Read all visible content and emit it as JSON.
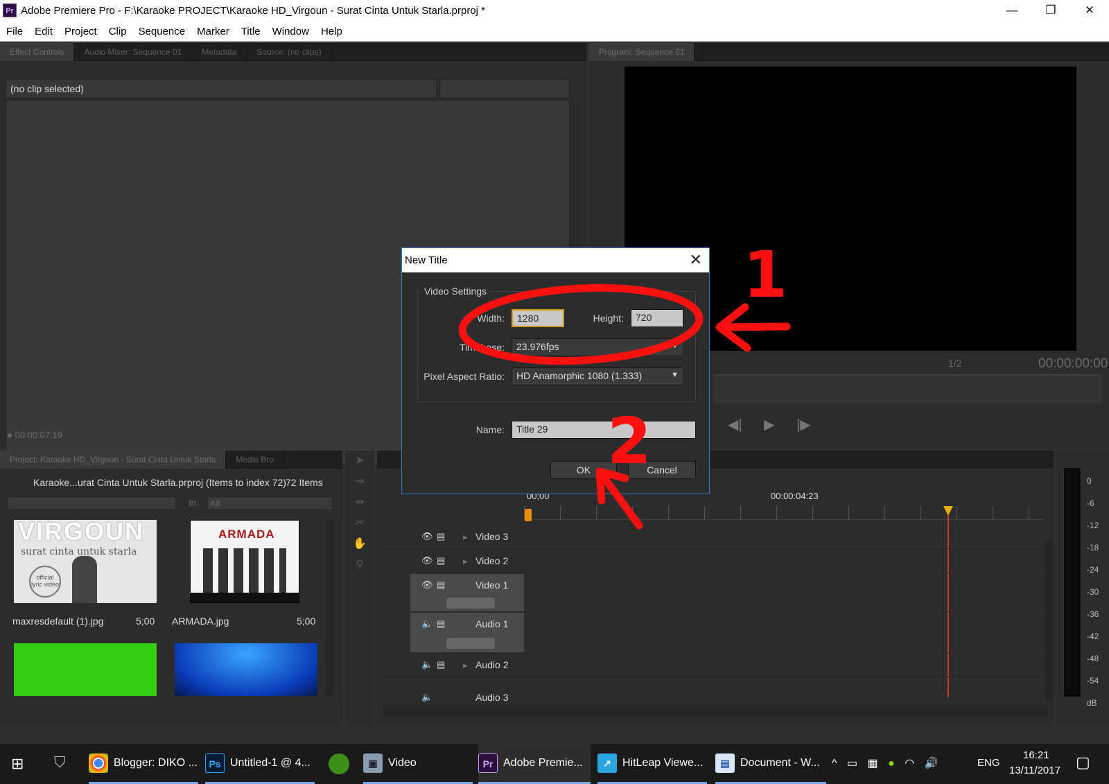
{
  "window": {
    "app_icon": "Pr",
    "title": "Adobe Premiere Pro - F:\\Karaoke PROJECT\\Karaoke HD_Virgoun - Surat Cinta Untuk Starla.prproj *",
    "min_icon": "—",
    "restore_icon": "❐",
    "close_icon": "✕"
  },
  "menu": [
    "File",
    "Edit",
    "Project",
    "Clip",
    "Sequence",
    "Marker",
    "Title",
    "Window",
    "Help"
  ],
  "source_panel": {
    "tabs": [
      "Effect Controls",
      "Audio Mixer: Sequence 01",
      "Metadata",
      "Source: (no clips)"
    ],
    "no_clip": "(no clip selected)",
    "timecode": "00:00:07:19"
  },
  "program_panel": {
    "tab": "Program: Sequence 01",
    "timecode": "00:00:00:00",
    "zoom": "1/2"
  },
  "project_panel": {
    "tabs": [
      "Project: Karaoke HD_Virgoun - Surat Cinta Untuk Starla",
      "Media Bro"
    ],
    "file_label": "Karaoke...urat Cinta Untuk Starla.prproj (Items to index 72)",
    "item_count": "72 Items",
    "in_label": "In:",
    "in_value": "All",
    "items": [
      {
        "name": "maxresdefault (1).jpg",
        "duration": "5;00"
      },
      {
        "name": "ARMADA.jpg",
        "duration": "5;00"
      }
    ],
    "thumb1_text": [
      "VIRGOUN",
      "surat cinta untuk starla",
      "official lyric video"
    ],
    "thumb2_text": "ARMADA"
  },
  "timeline": {
    "timecodes": [
      "00;00",
      "00:00:04:23"
    ],
    "tracks": [
      "Video 3",
      "Video 2",
      "Video 1",
      "Audio 1",
      "Audio 2",
      "Audio 3"
    ]
  },
  "vu_scale": [
    "0",
    "-6",
    "-12",
    "-18",
    "-24",
    "-30",
    "-36",
    "-42",
    "-48",
    "-54",
    "dB"
  ],
  "dialog": {
    "title": "New Title",
    "group": "Video Settings",
    "width_label": "Width:",
    "width_value": "1280",
    "height_label": "Height:",
    "height_value": "720",
    "timebase_label": "Timebase:",
    "timebase_value": "23.976fps",
    "par_label": "Pixel Aspect Ratio:",
    "par_value": "HD Anamorphic 1080 (1.333)",
    "name_label": "Name:",
    "name_value": "Title 29",
    "ok": "OK",
    "cancel": "Cancel"
  },
  "annotations": {
    "one": "1",
    "two": "2",
    "color": "#ff1010"
  },
  "taskbar": {
    "items": [
      {
        "label": "Blogger: DIKO ...",
        "icon": "chrome-icon"
      },
      {
        "label": "Untitled-1 @ 4...",
        "icon": "photoshop-icon"
      },
      {
        "label": "Video",
        "icon": "video-folder-icon"
      },
      {
        "label": "Adobe Premie...",
        "icon": "premiere-icon"
      },
      {
        "label": "HitLeap Viewe...",
        "icon": "hitleap-icon"
      },
      {
        "label": "Document - W...",
        "icon": "wordpad-icon"
      }
    ],
    "ps_glyph": "Ps",
    "pr_glyph": "Pr",
    "lang": "ENG",
    "time": "16:21",
    "date": "13/11/2017"
  }
}
